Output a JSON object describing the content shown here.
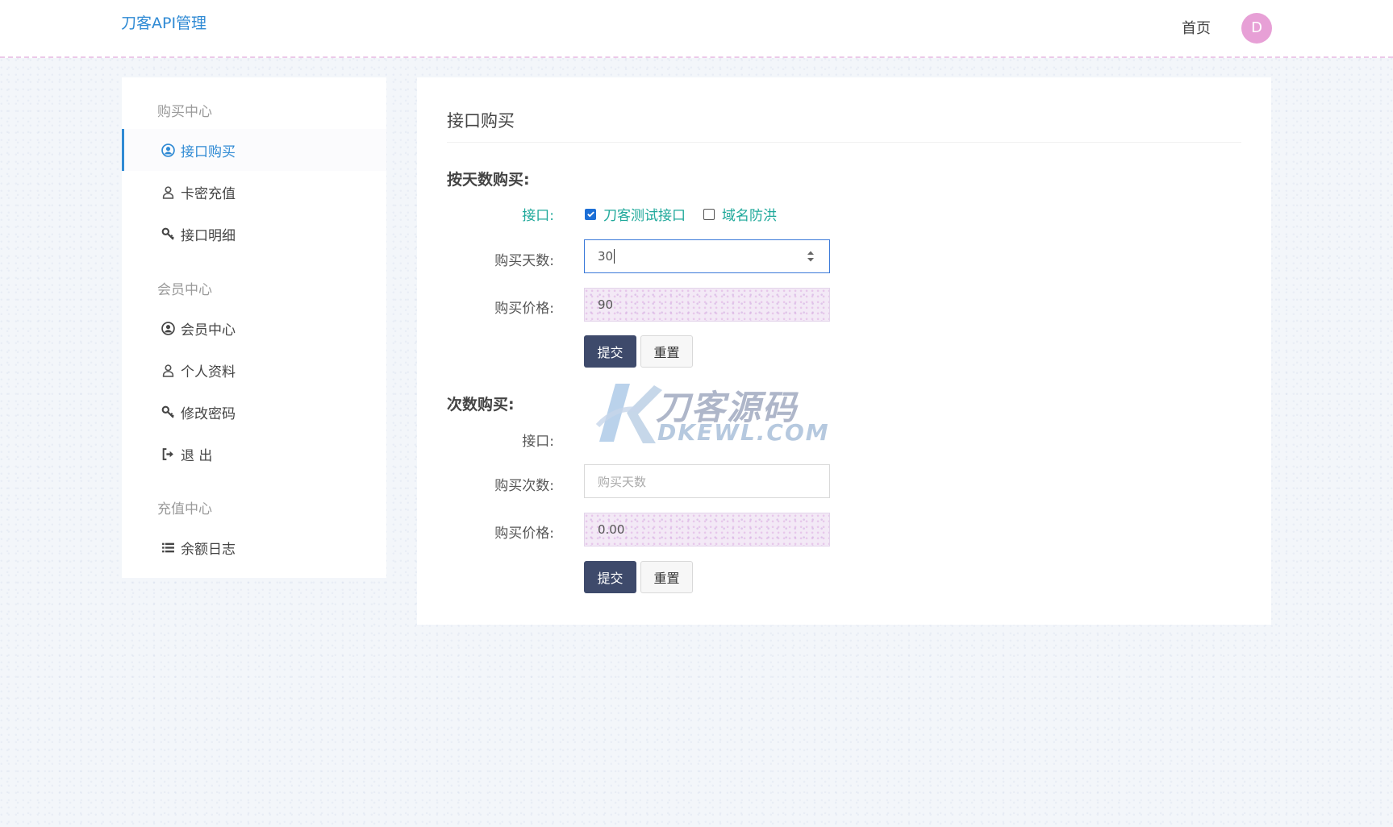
{
  "header": {
    "brand": "刀客API管理",
    "home": "首页",
    "avatar_letter": "D"
  },
  "sidebar": {
    "groups": [
      {
        "title": "购买中心",
        "items": [
          {
            "label": "接口购买",
            "icon": "user-circle-icon",
            "active": true
          },
          {
            "label": "卡密充值",
            "icon": "user-outline-icon"
          },
          {
            "label": "接口明细",
            "icon": "key-icon"
          }
        ]
      },
      {
        "title": "会员中心",
        "items": [
          {
            "label": "会员中心",
            "icon": "user-circle-icon"
          },
          {
            "label": "个人资料",
            "icon": "user-outline-icon"
          },
          {
            "label": "修改密码",
            "icon": "key-icon"
          },
          {
            "label": "退 出",
            "icon": "sign-out-icon"
          }
        ]
      },
      {
        "title": "充值中心",
        "items": [
          {
            "label": "余额日志",
            "icon": "list-icon"
          }
        ]
      }
    ]
  },
  "main": {
    "title": "接口购买",
    "by_days": {
      "title": "按天数购买:",
      "interface_label": "接口:",
      "options": [
        {
          "label": "刀客测试接口",
          "checked": true
        },
        {
          "label": "域名防洪",
          "checked": false
        }
      ],
      "days_label": "购买天数:",
      "days_value": "30",
      "price_label": "购买价格:",
      "price_value": "90",
      "submit": "提交",
      "reset": "重置"
    },
    "by_count": {
      "title": "次数购买:",
      "interface_label": "接口:",
      "count_label": "购买次数:",
      "count_placeholder": "购买天数",
      "price_label": "购买价格:",
      "price_value": "0.00",
      "submit": "提交",
      "reset": "重置"
    }
  },
  "watermark": {
    "cn": "刀客源码",
    "en": "DKEWL.COM"
  },
  "colors": {
    "accent": "#2f8ad4",
    "teal": "#1ea89a",
    "primary_button": "#3e4a6b",
    "avatar": "#e7a0d6"
  }
}
